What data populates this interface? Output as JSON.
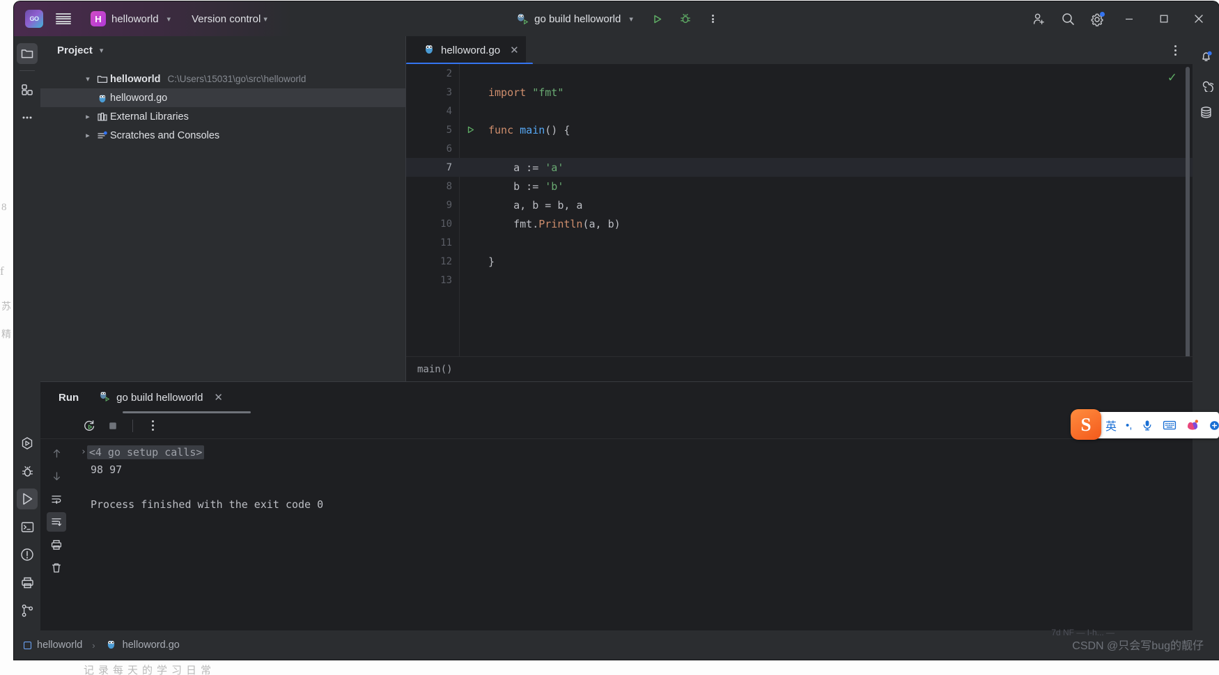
{
  "titlebar": {
    "app_icon": "goland-logo-icon",
    "menu_icon": "hamburger-menu-icon",
    "project_badge": "H",
    "project_name": "helloworld",
    "vcs_label": "Version control",
    "run_config": "go build helloworld",
    "run_icon": "run-triangle-icon",
    "debug_icon": "debug-bug-icon",
    "more_icon": "more-vertical-icon",
    "account_icon": "add-user-icon",
    "search_icon": "search-icon",
    "settings_icon": "gear-icon",
    "minimize_icon": "minimize-icon",
    "maximize_icon": "maximize-icon",
    "close_icon": "close-icon"
  },
  "left_rail": {
    "items": [
      {
        "name": "project-tool-icon",
        "active": true
      },
      {
        "name": "structure-tool-icon",
        "active": false
      },
      {
        "name": "more-tools-icon",
        "active": false
      }
    ],
    "bottom_items": [
      {
        "name": "services-icon",
        "active": false
      },
      {
        "name": "debug-icon",
        "active": false
      },
      {
        "name": "run-icon",
        "active": true
      },
      {
        "name": "terminal-icon",
        "active": false
      },
      {
        "name": "problems-icon",
        "active": false
      },
      {
        "name": "print-icon",
        "active": false
      },
      {
        "name": "version-control-icon",
        "active": false
      }
    ]
  },
  "right_rail": {
    "items": [
      {
        "name": "notifications-bell-icon",
        "badge": true
      },
      {
        "name": "ai-assistant-icon",
        "badge": false
      },
      {
        "name": "database-icon",
        "badge": false
      }
    ]
  },
  "project_panel": {
    "title": "Project",
    "chevron": "chevron-down-icon",
    "tree": [
      {
        "twisty": "v",
        "icon": "folder-icon",
        "label": "helloworld",
        "bold": true,
        "sub": "C:\\Users\\15031\\go\\src\\helloworld",
        "selected": false,
        "indent": 0
      },
      {
        "twisty": "",
        "icon": "go-file-icon",
        "label": "helloword.go",
        "bold": false,
        "sub": "",
        "selected": true,
        "indent": 1
      },
      {
        "twisty": ">",
        "icon": "library-icon",
        "label": "External Libraries",
        "bold": false,
        "sub": "",
        "selected": false,
        "indent": 0
      },
      {
        "twisty": ">",
        "icon": "scratches-icon",
        "label": "Scratches and Consoles",
        "bold": false,
        "sub": "",
        "selected": false,
        "indent": 0
      }
    ]
  },
  "editor": {
    "tab": {
      "icon": "go-file-icon",
      "name": "helloword.go",
      "close": "close-icon"
    },
    "kebab": "more-vertical-icon",
    "inspection_status": "check-ok-icon",
    "breadcrumb": "main()",
    "lines": [
      {
        "num": "2",
        "text": "",
        "current": false,
        "runmarker": false
      },
      {
        "num": "3",
        "text": "import \"fmt\"",
        "current": false,
        "runmarker": false
      },
      {
        "num": "4",
        "text": "",
        "current": false,
        "runmarker": false
      },
      {
        "num": "5",
        "text": "func main() {",
        "current": false,
        "runmarker": true
      },
      {
        "num": "6",
        "text": "",
        "current": false,
        "runmarker": false
      },
      {
        "num": "7",
        "text": "    a := 'a'",
        "current": true,
        "runmarker": false
      },
      {
        "num": "8",
        "text": "    b := 'b'",
        "current": false,
        "runmarker": false
      },
      {
        "num": "9",
        "text": "    a, b = b, a",
        "current": false,
        "runmarker": false
      },
      {
        "num": "10",
        "text": "    fmt.Println(a, b)",
        "current": false,
        "runmarker": false
      },
      {
        "num": "11",
        "text": "",
        "current": false,
        "runmarker": false
      },
      {
        "num": "12",
        "text": "}",
        "current": false,
        "runmarker": false
      },
      {
        "num": "13",
        "text": "",
        "current": false,
        "runmarker": false
      }
    ]
  },
  "run_panel": {
    "title": "Run",
    "tab_label": "go build helloworld",
    "tab_icon": "go-run-icon",
    "tab_close": "close-icon",
    "toolbar": [
      {
        "name": "rerun-icon"
      },
      {
        "name": "stop-icon"
      },
      {
        "name": "more-vertical-icon"
      }
    ],
    "gutter": [
      {
        "name": "scroll-up-icon",
        "active": false
      },
      {
        "name": "scroll-down-icon",
        "active": false
      },
      {
        "name": "soft-wrap-icon",
        "active": false
      },
      {
        "name": "scroll-to-end-icon",
        "active": true
      },
      {
        "name": "print-icon",
        "active": false
      },
      {
        "name": "clear-all-icon",
        "active": false
      }
    ],
    "console": {
      "fold_label": "<4 go setup calls>",
      "fold_arrow": "›",
      "output": "98 97",
      "blank": "",
      "exit_line": "Process finished with the exit code 0"
    }
  },
  "statusbar": {
    "project_label": "helloworld",
    "separator": "›",
    "file_label": "helloword.go",
    "project_icon": "module-square-icon",
    "file_icon": "go-file-icon"
  },
  "ime": {
    "logo": "S",
    "mode": "英",
    "punct_icon": "punctuation-icon",
    "mic_icon": "microphone-icon",
    "keyboard_icon": "keyboard-icon",
    "skin_icon": "skin-icon",
    "menu_icon": "ime-menu-icon"
  },
  "watermark": {
    "text": "CSDN @只会写bug的靓仔",
    "sub": "7d NF  —  I-h... —"
  },
  "colors": {
    "accent_blue": "#3574f0",
    "ide_bg": "#1e1f22",
    "panel_bg": "#2b2d30",
    "keyword": "#cf8e6d",
    "string": "#6aab73",
    "function": "#56a8f5",
    "text": "#bcbec4",
    "green_run": "#5fad65"
  }
}
